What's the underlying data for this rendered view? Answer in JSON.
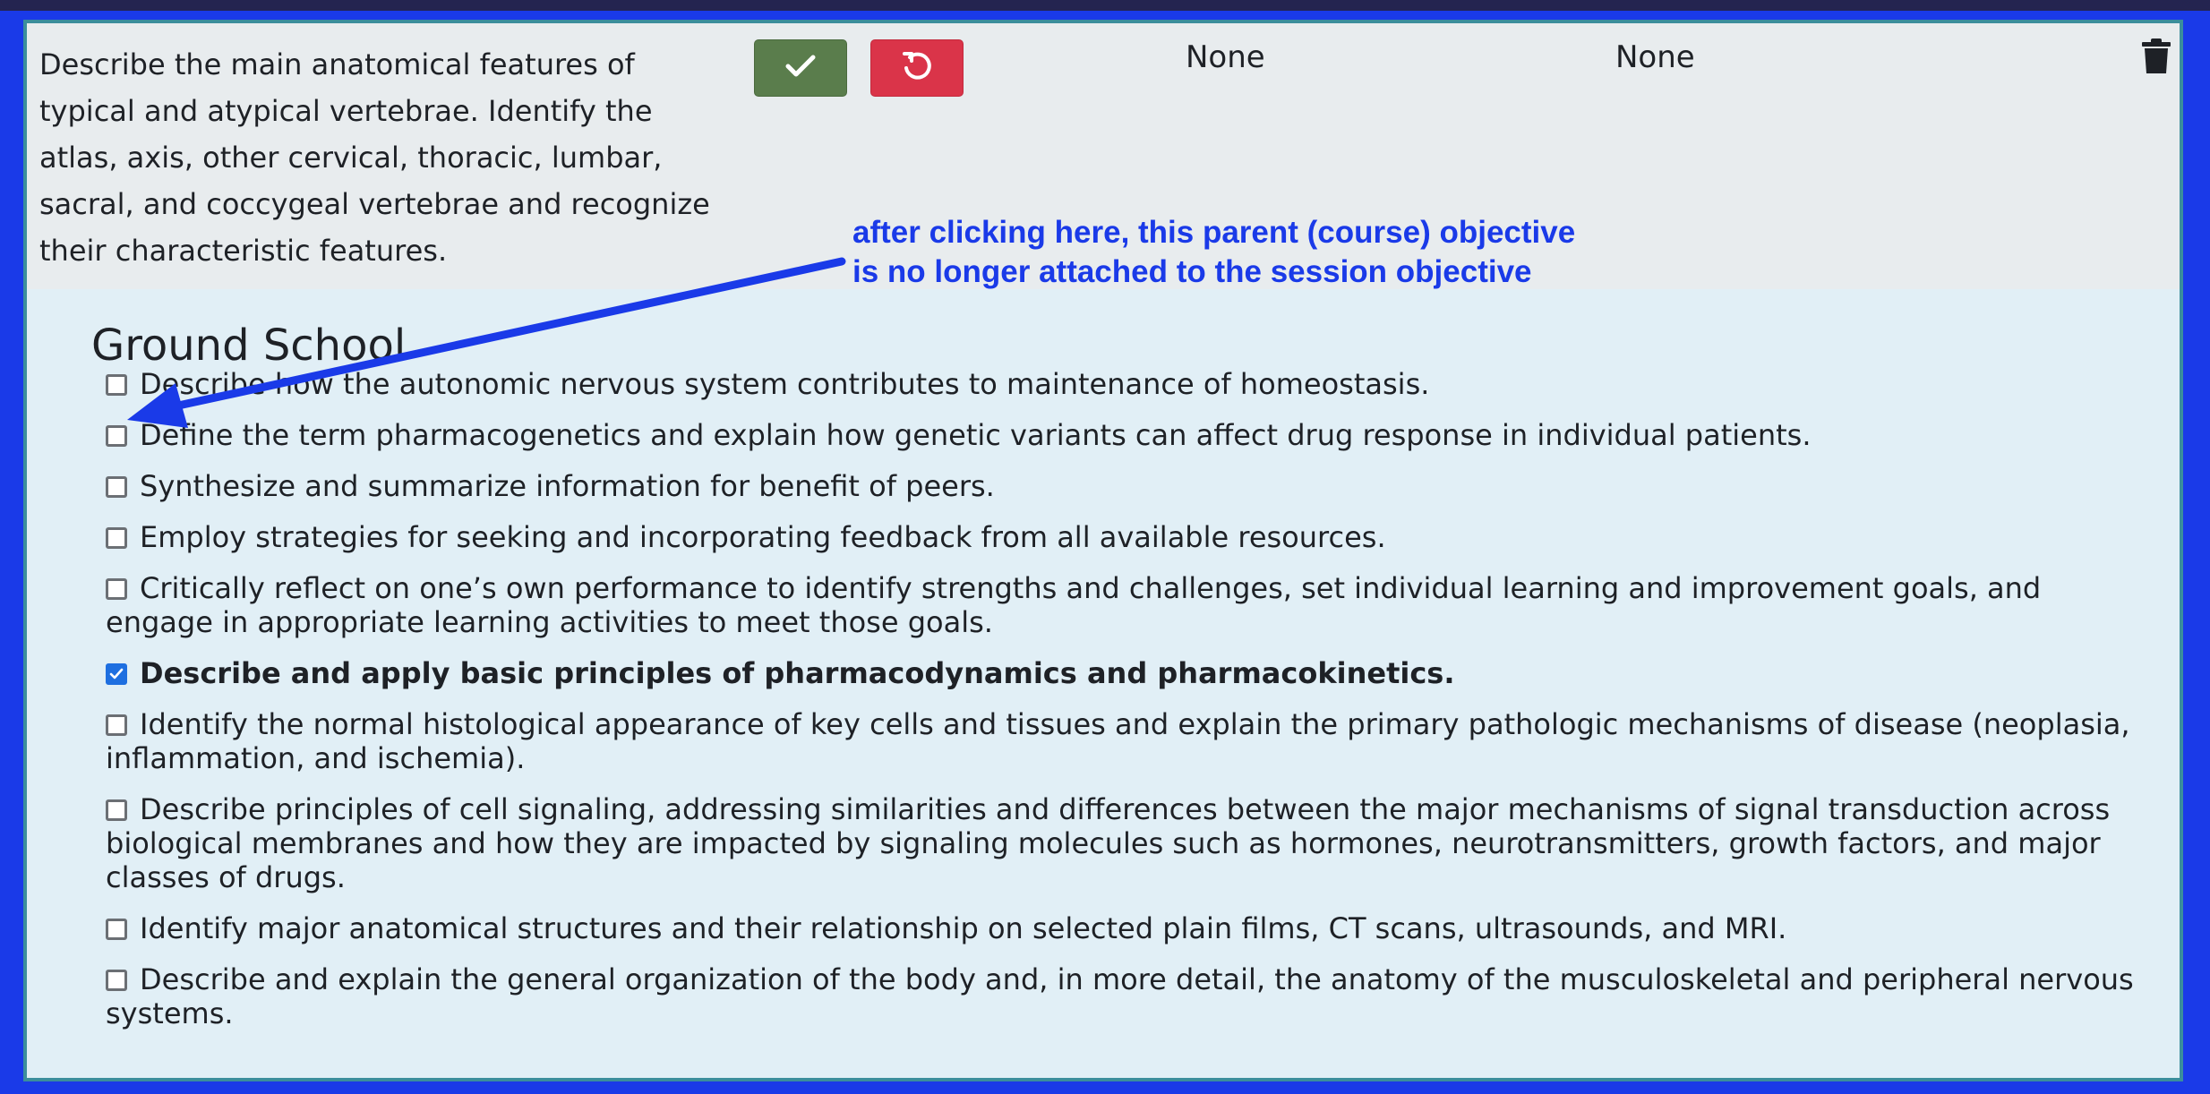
{
  "objective_row": {
    "description": "Describe the main anatomical features of typical and atypical vertebrae. Identify the atlas, axis, other cervical, thoracic, lumbar, sacral, and coccygeal vertebrae and recognize their characteristic features.",
    "value_1": "None",
    "value_2": "None",
    "icons": {
      "save": "check-icon",
      "undo": "undo-icon",
      "delete": "trash-icon"
    },
    "colors": {
      "save": "#5a7d4c",
      "undo": "#da3449"
    }
  },
  "group": {
    "title": "Ground School",
    "objectives": [
      {
        "text": "Describe how the autonomic nervous system contributes to maintenance of homeostasis.",
        "checked": false
      },
      {
        "text": "Define the term pharmacogenetics and explain how genetic variants can affect drug response in individual patients.",
        "checked": false
      },
      {
        "text": "Synthesize and summarize information for benefit of peers.",
        "checked": false
      },
      {
        "text": "Employ strategies for seeking and incorporating feedback from all available resources.",
        "checked": false
      },
      {
        "text": "Critically reflect on one’s own performance to identify strengths and challenges, set individual learning and improvement goals, and engage in appropriate learning activities to meet those goals.",
        "checked": false
      },
      {
        "text": "Describe and apply basic principles of pharmacodynamics and pharmacokinetics.",
        "checked": true
      },
      {
        "text": "Identify the normal histological appearance of key cells and tissues and explain the primary pathologic mechanisms of disease (neoplasia, inflammation, and ischemia).",
        "checked": false
      },
      {
        "text": "Describe principles of cell signaling, addressing similarities and differences between the major mechanisms of signal transduction across biological membranes and how they are impacted by signaling molecules such as hormones, neurotransmitters, growth factors, and major classes of drugs.",
        "checked": false
      },
      {
        "text": "Identify major anatomical structures and their relationship on selected plain films, CT scans, ultrasounds, and MRI.",
        "checked": false
      },
      {
        "text": "Describe and explain the general organization of the body and, in more detail, the anatomy of the musculoskeletal and peripheral nervous systems.",
        "checked": false
      }
    ]
  },
  "annotation": {
    "line_1": "after clicking here, this parent (course) objective",
    "line_2": "is no longer attached to the session objective",
    "color": "#1a3ae8"
  }
}
